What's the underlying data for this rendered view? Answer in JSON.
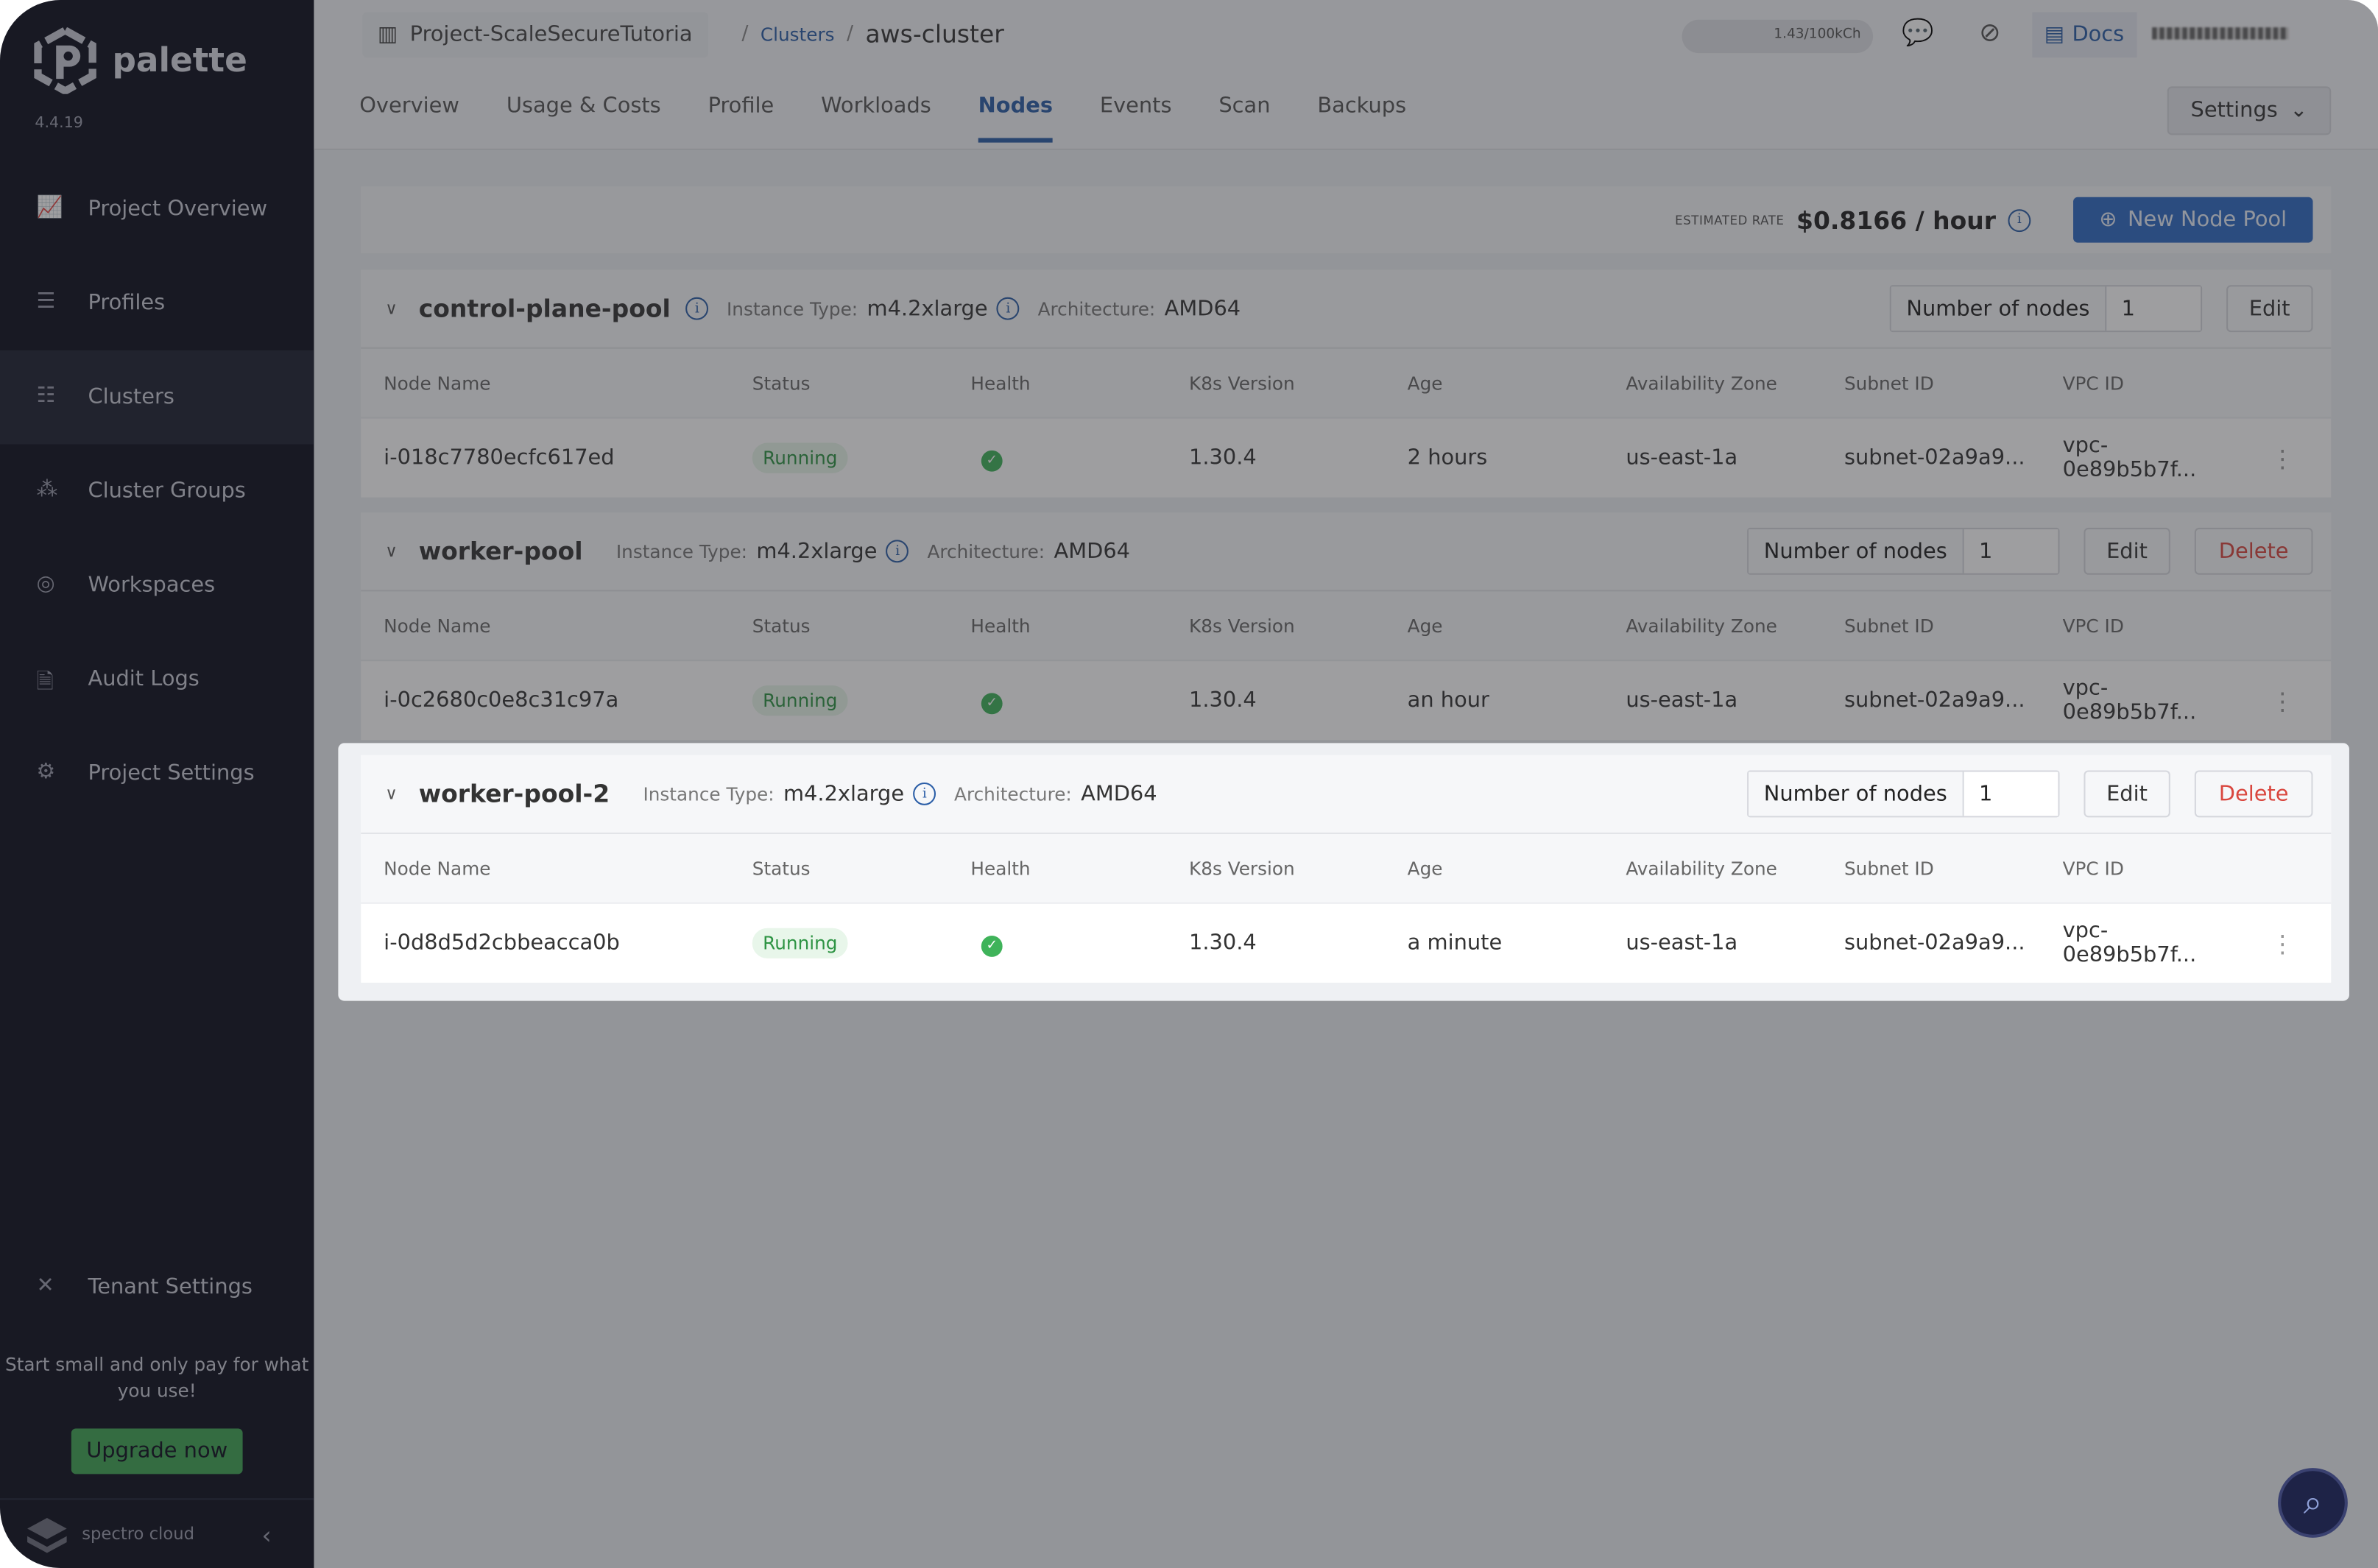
{
  "app": {
    "name": "palette",
    "version": "4.4.19"
  },
  "sidebar": {
    "items": [
      {
        "label": "Project Overview",
        "icon": "chart-icon"
      },
      {
        "label": "Profiles",
        "icon": "stack-icon"
      },
      {
        "label": "Clusters",
        "icon": "clusters-icon",
        "active": true
      },
      {
        "label": "Cluster Groups",
        "icon": "network-icon"
      },
      {
        "label": "Workspaces",
        "icon": "target-icon"
      },
      {
        "label": "Audit Logs",
        "icon": "document-search-icon"
      },
      {
        "label": "Project Settings",
        "icon": "gear-icon"
      }
    ],
    "tenant_settings": "Tenant Settings",
    "promo": "Start small and only pay for what you use!",
    "upgrade": "Upgrade now",
    "footer_brand": "spectro cloud"
  },
  "header": {
    "project": "Project-ScaleSecureTutoria",
    "crumb_link": "Clusters",
    "crumb_current": "aws-cluster",
    "credits": "1.43/100kCh",
    "docs": "Docs"
  },
  "tabs": [
    "Overview",
    "Usage & Costs",
    "Profile",
    "Workloads",
    "Nodes",
    "Events",
    "Scan",
    "Backups"
  ],
  "active_tab": "Nodes",
  "settings": "Settings",
  "rate": {
    "label": "ESTIMATED RATE",
    "value": "$0.8166 / hour"
  },
  "new_pool": "New Node Pool",
  "labels": {
    "instance_type": "Instance Type:",
    "architecture": "Architecture:",
    "number_of_nodes": "Number of nodes",
    "edit": "Edit",
    "delete": "Delete"
  },
  "columns": [
    "Node Name",
    "Status",
    "Health",
    "K8s Version",
    "Age",
    "Availability Zone",
    "Subnet ID",
    "VPC ID"
  ],
  "pools": [
    {
      "name": "control-plane-pool",
      "instance_type": "m4.2xlarge",
      "architecture": "AMD64",
      "nodes": "1",
      "deletable": false,
      "rows": [
        {
          "name": "i-018c7780ecfc617ed",
          "status": "Running",
          "health": "healthy",
          "k8s": "1.30.4",
          "age": "2 hours",
          "az": "us-east-1a",
          "subnet": "subnet-02a9a9...",
          "vpc": "vpc-0e89b5b7f..."
        }
      ]
    },
    {
      "name": "worker-pool",
      "instance_type": "m4.2xlarge",
      "architecture": "AMD64",
      "nodes": "1",
      "deletable": true,
      "rows": [
        {
          "name": "i-0c2680c0e8c31c97a",
          "status": "Running",
          "health": "healthy",
          "k8s": "1.30.4",
          "age": "an hour",
          "az": "us-east-1a",
          "subnet": "subnet-02a9a9...",
          "vpc": "vpc-0e89b5b7f..."
        }
      ]
    },
    {
      "name": "worker-pool-2",
      "instance_type": "m4.2xlarge",
      "architecture": "AMD64",
      "nodes": "1",
      "deletable": true,
      "highlighted": true,
      "rows": [
        {
          "name": "i-0d8d5d2cbbeacca0b",
          "status": "Running",
          "health": "healthy",
          "k8s": "1.30.4",
          "age": "a minute",
          "az": "us-east-1a",
          "subnet": "subnet-02a9a9...",
          "vpc": "vpc-0e89b5b7f..."
        }
      ]
    }
  ],
  "colors": {
    "accent": "#2b5ea7",
    "sidebar": "#0b0d1c",
    "running": "#2e9444",
    "delete": "#d9463e",
    "upgrade": "#3fa552"
  }
}
